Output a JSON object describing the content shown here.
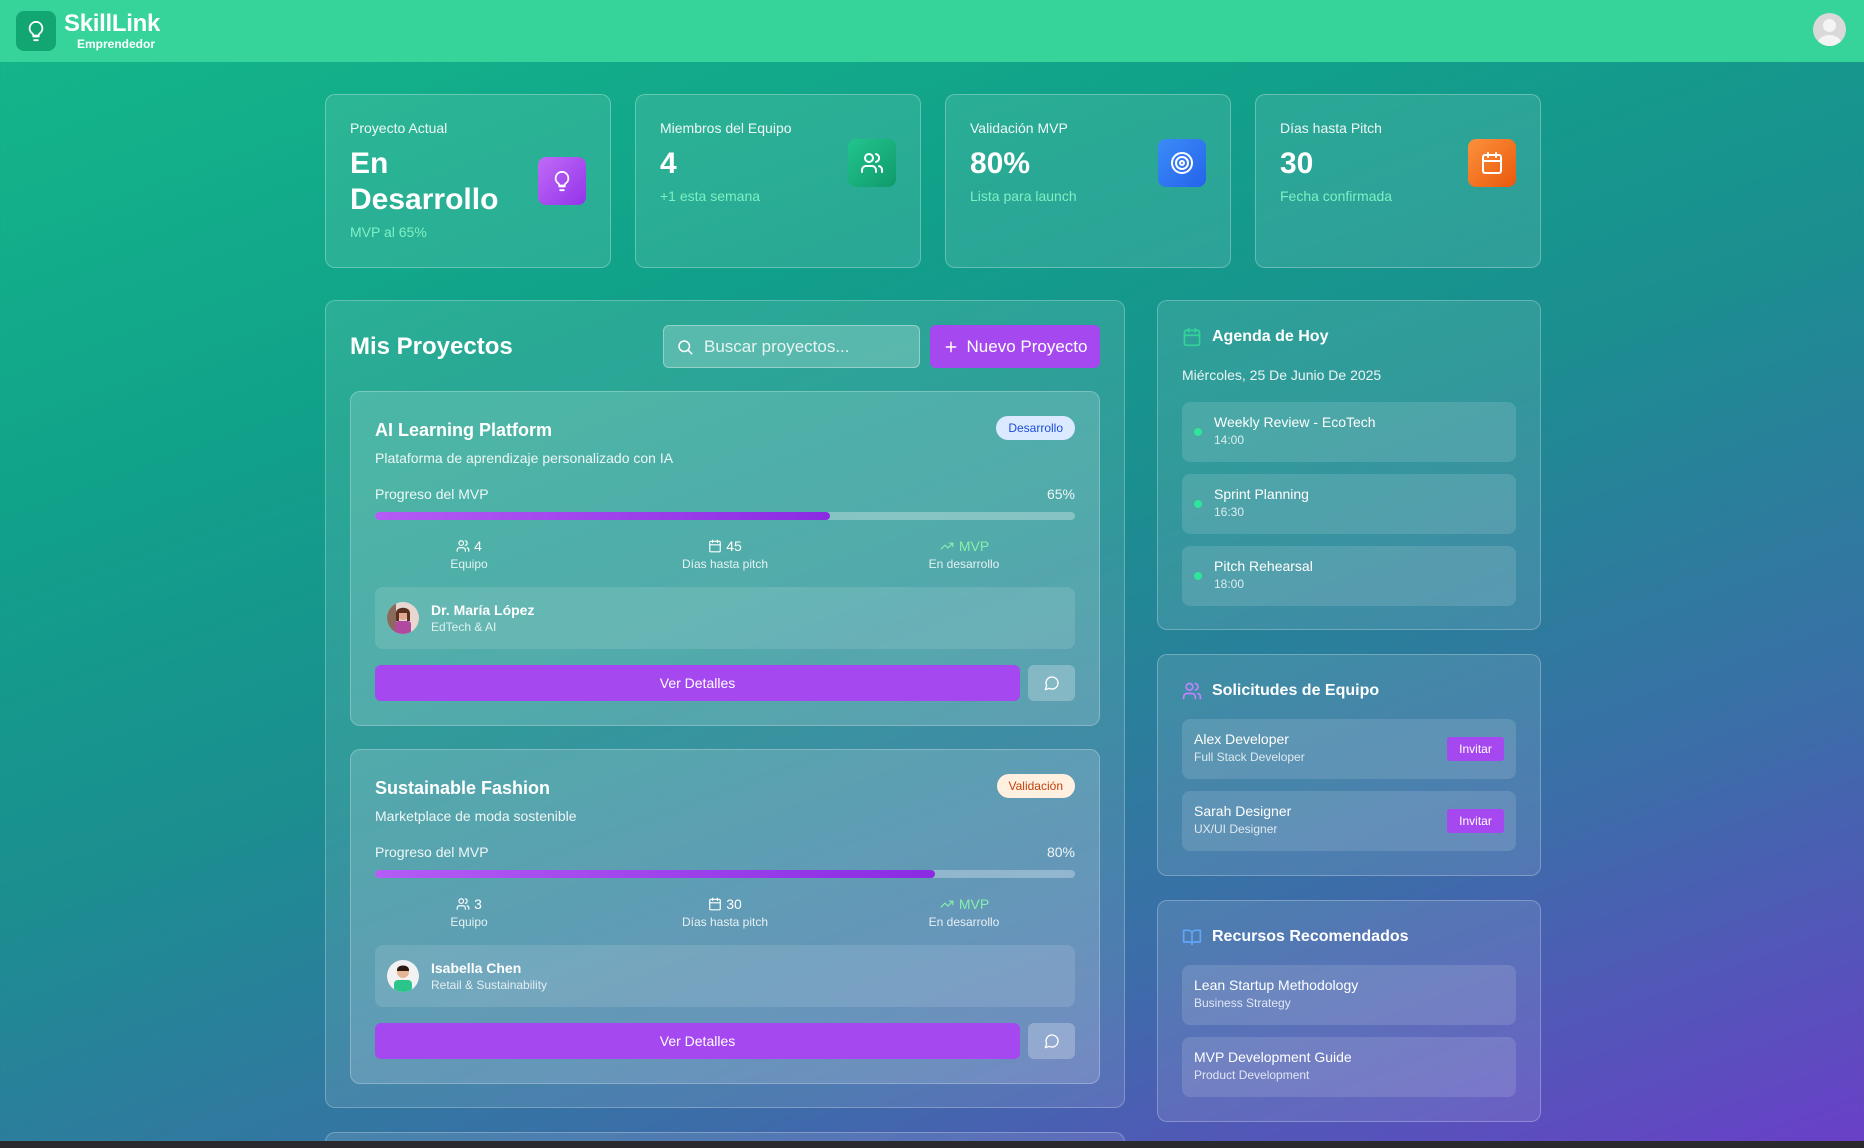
{
  "app": {
    "name": "SkillLink",
    "role": "Emprendedor"
  },
  "stats": [
    {
      "label": "Proyecto Actual",
      "value": "En Desarrollo",
      "sub": "MVP al 65%",
      "icon": "lightbulb-icon",
      "color": "#a855f7"
    },
    {
      "label": "Miembros del Equipo",
      "value": "4",
      "sub": "+1 esta semana",
      "icon": "users-icon",
      "color": "#12a673"
    },
    {
      "label": "Validación MVP",
      "value": "80%",
      "sub": "Lista para launch",
      "icon": "target-icon",
      "color": "#2f7ff0"
    },
    {
      "label": "Días hasta Pitch",
      "value": "30",
      "sub": "Fecha confirmada",
      "icon": "calendar-icon",
      "color": "#f97316"
    }
  ],
  "projects_panel": {
    "title": "Mis Proyectos",
    "search_placeholder": "Buscar proyectos...",
    "new_button": "Nuevo Proyecto",
    "progress_label": "Progreso del MVP",
    "metric_team_label": "Equipo",
    "metric_days_label": "Días hasta pitch",
    "metric_mvp_value": "MVP",
    "metric_mvp_label": "En desarrollo",
    "details_button": "Ver Detalles",
    "items": [
      {
        "title": "AI Learning Platform",
        "desc": "Plataforma de aprendizaje personalizado con IA",
        "badge": "Desarrollo",
        "progress": "65%",
        "progress_value": 65,
        "team": "4",
        "days": "45",
        "mentor_name": "Dr. María López",
        "mentor_field": "EdTech & AI"
      },
      {
        "title": "Sustainable Fashion",
        "desc": "Marketplace de moda sostenible",
        "badge": "Validación",
        "progress": "80%",
        "progress_value": 80,
        "team": "3",
        "days": "30",
        "mentor_name": "Isabella Chen",
        "mentor_field": "Retail & Sustainability"
      }
    ]
  },
  "agenda": {
    "title": "Agenda de Hoy",
    "date": "Miércoles, 25 De Junio De 2025",
    "items": [
      {
        "name": "Weekly Review - EcoTech",
        "time": "14:00"
      },
      {
        "name": "Sprint Planning",
        "time": "16:30"
      },
      {
        "name": "Pitch Rehearsal",
        "time": "18:00"
      }
    ]
  },
  "team_requests": {
    "title": "Solicitudes de Equipo",
    "invite_label": "Invitar",
    "items": [
      {
        "name": "Alex Developer",
        "role": "Full Stack Developer"
      },
      {
        "name": "Sarah Designer",
        "role": "UX/UI Designer"
      }
    ]
  },
  "resources": {
    "title": "Recursos Recomendados",
    "items": [
      {
        "name": "Lean Startup Methodology",
        "category": "Business Strategy"
      },
      {
        "name": "MVP Development Guide",
        "category": "Product Development"
      }
    ]
  }
}
